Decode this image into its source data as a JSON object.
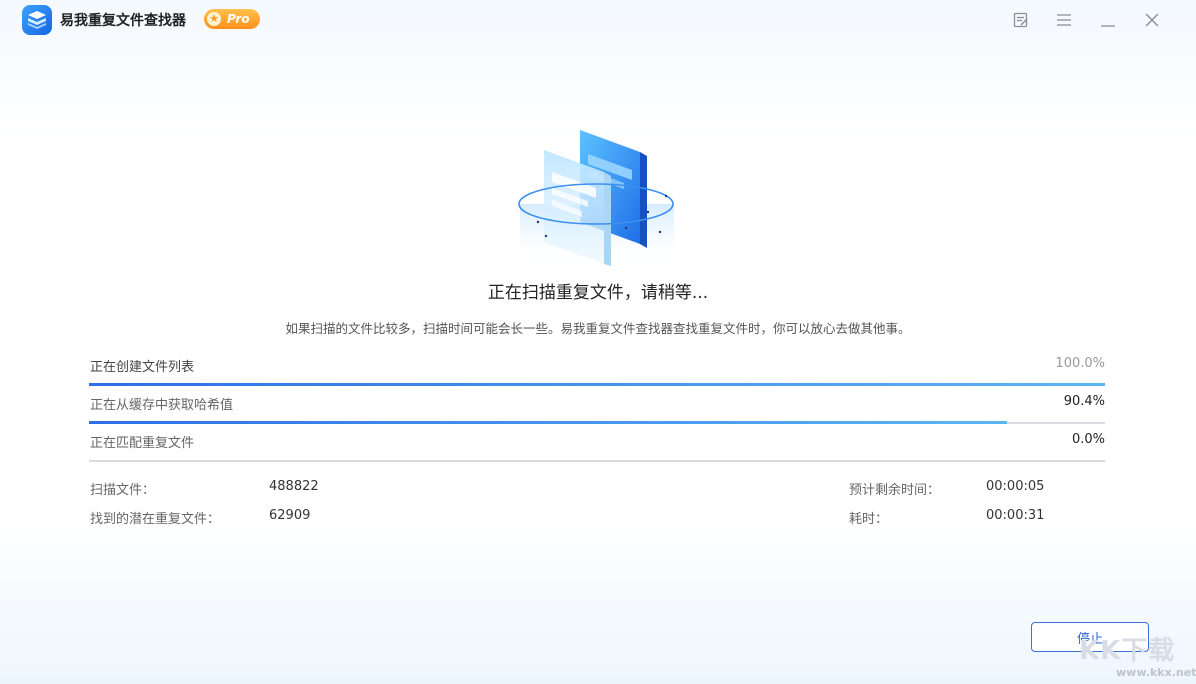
{
  "app": {
    "title": "易我重复文件查找器",
    "badge": "Pro"
  },
  "window_controls": [
    "feedback-icon",
    "menu-icon",
    "minimize-icon",
    "close-icon"
  ],
  "status": {
    "headline": "正在扫描重复文件，请稍等...",
    "subtitle": "如果扫描的文件比较多，扫描时间可能会长一些。易我重复文件查找器查找重复文件时，你可以放心去做其他事。"
  },
  "steps": [
    {
      "label": "正在创建文件列表",
      "percent_text": "100.0%",
      "progress": 1.0
    },
    {
      "label": "正在从缓存中获取哈希值",
      "percent_text": "90.4%",
      "progress": 0.904
    },
    {
      "label": "正在匹配重复文件",
      "percent_text": "0.0%",
      "progress": 0.0
    }
  ],
  "stats": {
    "scanned_label": "扫描文件：",
    "scanned_value": "488822",
    "found_label": "找到的潜在重复文件：",
    "found_value": "62909",
    "remaining_label": "预计剩余时间：",
    "remaining_value": "00:00:05",
    "elapsed_label": "耗时：",
    "elapsed_value": "00:00:31"
  },
  "actions": {
    "stop_label": "停止"
  },
  "watermark": {
    "text": "KK下载",
    "url": "www.kkx.net"
  },
  "colors": {
    "accent": "#2f64d8",
    "progress_start": "#2e6fe8",
    "progress_end": "#5bb6f4",
    "badge": "#ff9b1f"
  }
}
